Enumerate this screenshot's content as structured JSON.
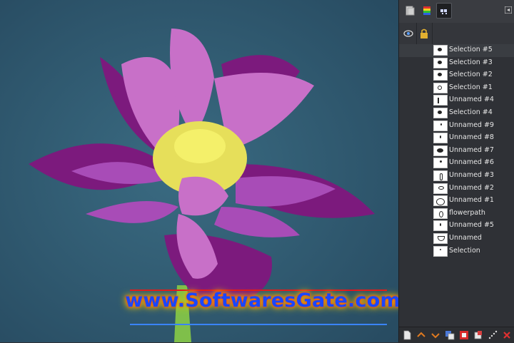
{
  "canvas": {
    "background": "#2f5a72",
    "petal_dark": "#7c1a7d",
    "petal_mid": "#a84cb7",
    "petal_light": "#c870c8",
    "center_yellow": "#f4f06a",
    "stem_green": "#7fbf4a"
  },
  "watermark": {
    "text": "www.SoftwaresGate.com"
  },
  "panel": {
    "tabs": [
      {
        "name": "layers-tab",
        "icon": "page-stack-icon"
      },
      {
        "name": "colors-tab",
        "icon": "color-swatches-icon"
      },
      {
        "name": "objects-tab",
        "icon": "objects-icon"
      }
    ],
    "header": {
      "visibility_icon": "eye-icon",
      "lock_icon": "lock-icon"
    },
    "layers": [
      {
        "label": "Selection #5",
        "selected": true
      },
      {
        "label": "Selection #3",
        "selected": false
      },
      {
        "label": "Selection #2",
        "selected": false
      },
      {
        "label": "Selection #1",
        "selected": false
      },
      {
        "label": "Unnamed #4",
        "selected": false
      },
      {
        "label": "Selection #4",
        "selected": false
      },
      {
        "label": "Unnamed #9",
        "selected": false
      },
      {
        "label": "Unnamed #8",
        "selected": false
      },
      {
        "label": "Unnamed #7",
        "selected": false
      },
      {
        "label": "Unnamed #6",
        "selected": false
      },
      {
        "label": "Unnamed #3",
        "selected": false
      },
      {
        "label": "Unnamed #2",
        "selected": false
      },
      {
        "label": "Unnamed #1",
        "selected": false
      },
      {
        "label": "flowerpath",
        "selected": false
      },
      {
        "label": "Unnamed #5",
        "selected": false
      },
      {
        "label": "Unnamed",
        "selected": false
      },
      {
        "label": "Selection",
        "selected": false
      }
    ],
    "bottom_toolbar": [
      "new-layer-icon",
      "move-up-icon",
      "move-down-icon",
      "duplicate-icon",
      "mask-icon",
      "merge-icon",
      "scatter-icon",
      "delete-icon"
    ]
  }
}
